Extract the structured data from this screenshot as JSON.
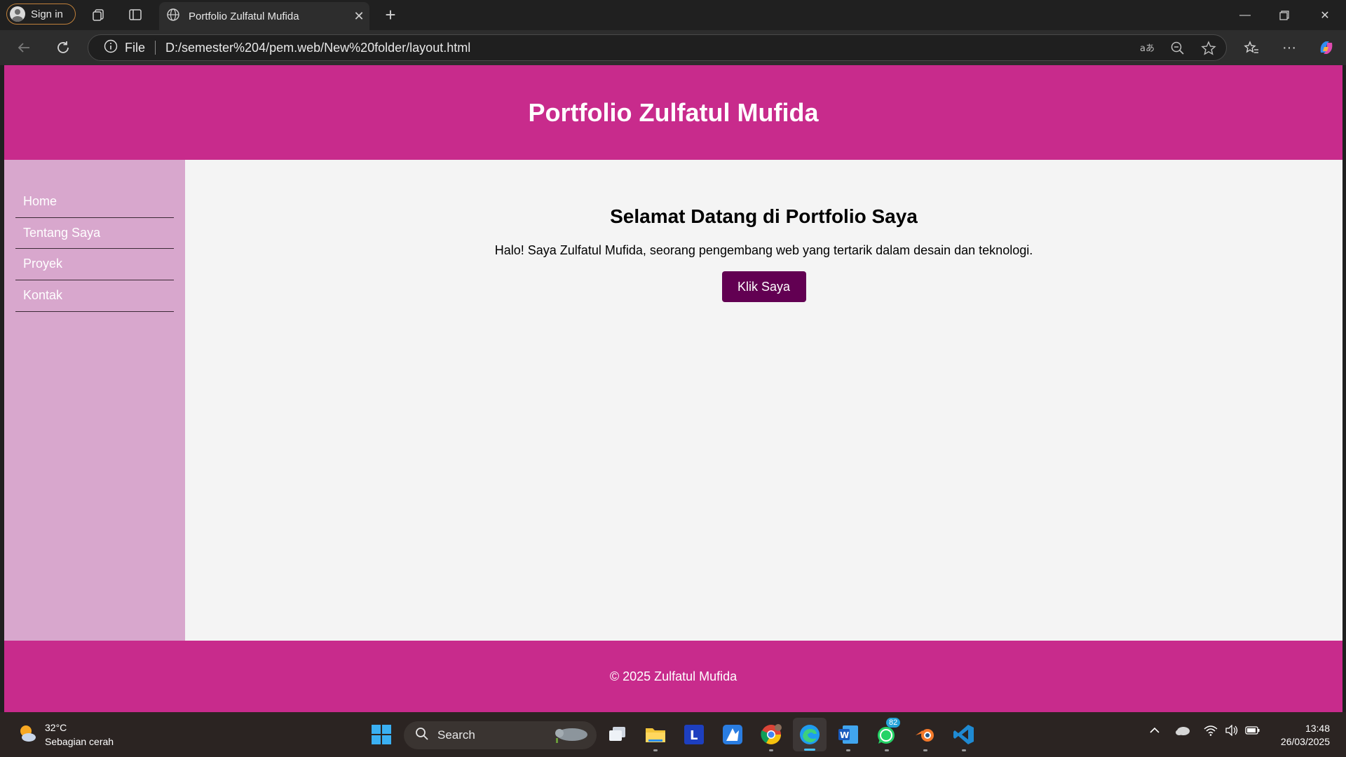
{
  "browser": {
    "signin_label": "Sign in",
    "tab_title": "Portfolio Zulfatul Mufida",
    "address_scheme": "File",
    "address_url": "D:/semester%204/pem.web/New%20folder/layout.html"
  },
  "site": {
    "title": "Portfolio Zulfatul Mufida",
    "nav": [
      "Home",
      "Tentang Saya",
      "Proyek",
      "Kontak"
    ],
    "heading": "Selamat Datang di Portfolio Saya",
    "intro": "Halo! Saya Zulfatul Mufida, seorang pengembang web yang tertarik dalam desain dan teknologi.",
    "button_label": "Klik Saya",
    "footer": "© 2025 Zulfatul Mufida",
    "colors": {
      "header": "#c82b8c",
      "sidebar": "#d8a7cd",
      "button": "#620052",
      "content_bg": "#f4f4f4"
    }
  },
  "taskbar": {
    "weather_temp": "32°C",
    "weather_desc": "Sebagian cerah",
    "search_label": "Search",
    "whatsapp_badge": "82",
    "time": "13:48",
    "date": "26/03/2025"
  }
}
